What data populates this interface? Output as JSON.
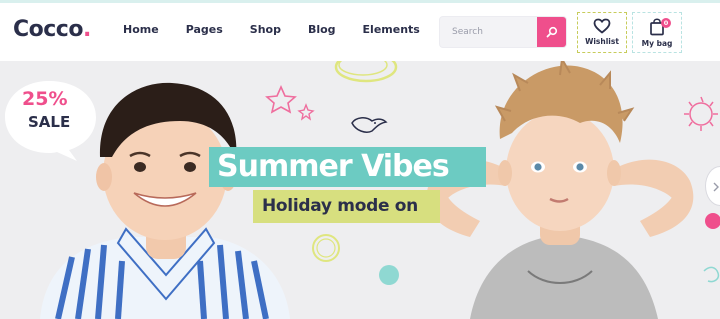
{
  "header": {
    "logo_text": "Cocco",
    "logo_dot": ".",
    "nav": [
      {
        "label": "Home",
        "active": true
      },
      {
        "label": "Pages",
        "active": false
      },
      {
        "label": "Shop",
        "active": false
      },
      {
        "label": "Blog",
        "active": false
      },
      {
        "label": "Elements",
        "active": false
      }
    ],
    "search": {
      "placeholder": "Search",
      "value": ""
    },
    "wishlist_label": "Wishlist",
    "bag_label": "My bag",
    "bag_count": "0"
  },
  "hero": {
    "sale_percent": "25%",
    "sale_word": "SALE",
    "title": "Summer Vibes",
    "subtitle": "Holiday mode on"
  },
  "colors": {
    "accent_pink": "#ef4f8c",
    "accent_teal": "#6ccbc2",
    "accent_lime": "#d7df7f",
    "dark": "#2b2f4a"
  }
}
